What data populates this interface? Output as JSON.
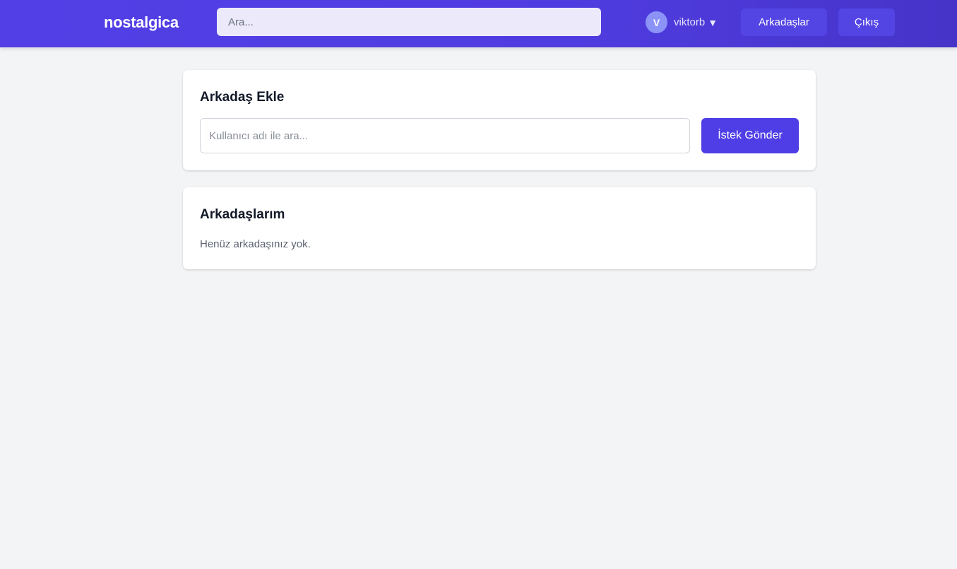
{
  "navbar": {
    "brand": "nostalgica",
    "search_placeholder": "Ara...",
    "user": {
      "initial": "V",
      "name": "viktorb",
      "caret": "▼"
    },
    "friends_label": "Arkadaşlar",
    "logout_label": "Çıkış"
  },
  "add_friend": {
    "title": "Arkadaş Ekle",
    "input_placeholder": "Kullanıcı adı ile ara...",
    "input_value": "",
    "send_label": "İstek Gönder"
  },
  "friends": {
    "title": "Arkadaşlarım",
    "empty_message": "Henüz arkadaşınız yok."
  },
  "colors": {
    "brand_primary": "#4f3ee6",
    "page_background": "#f3f4f6"
  }
}
